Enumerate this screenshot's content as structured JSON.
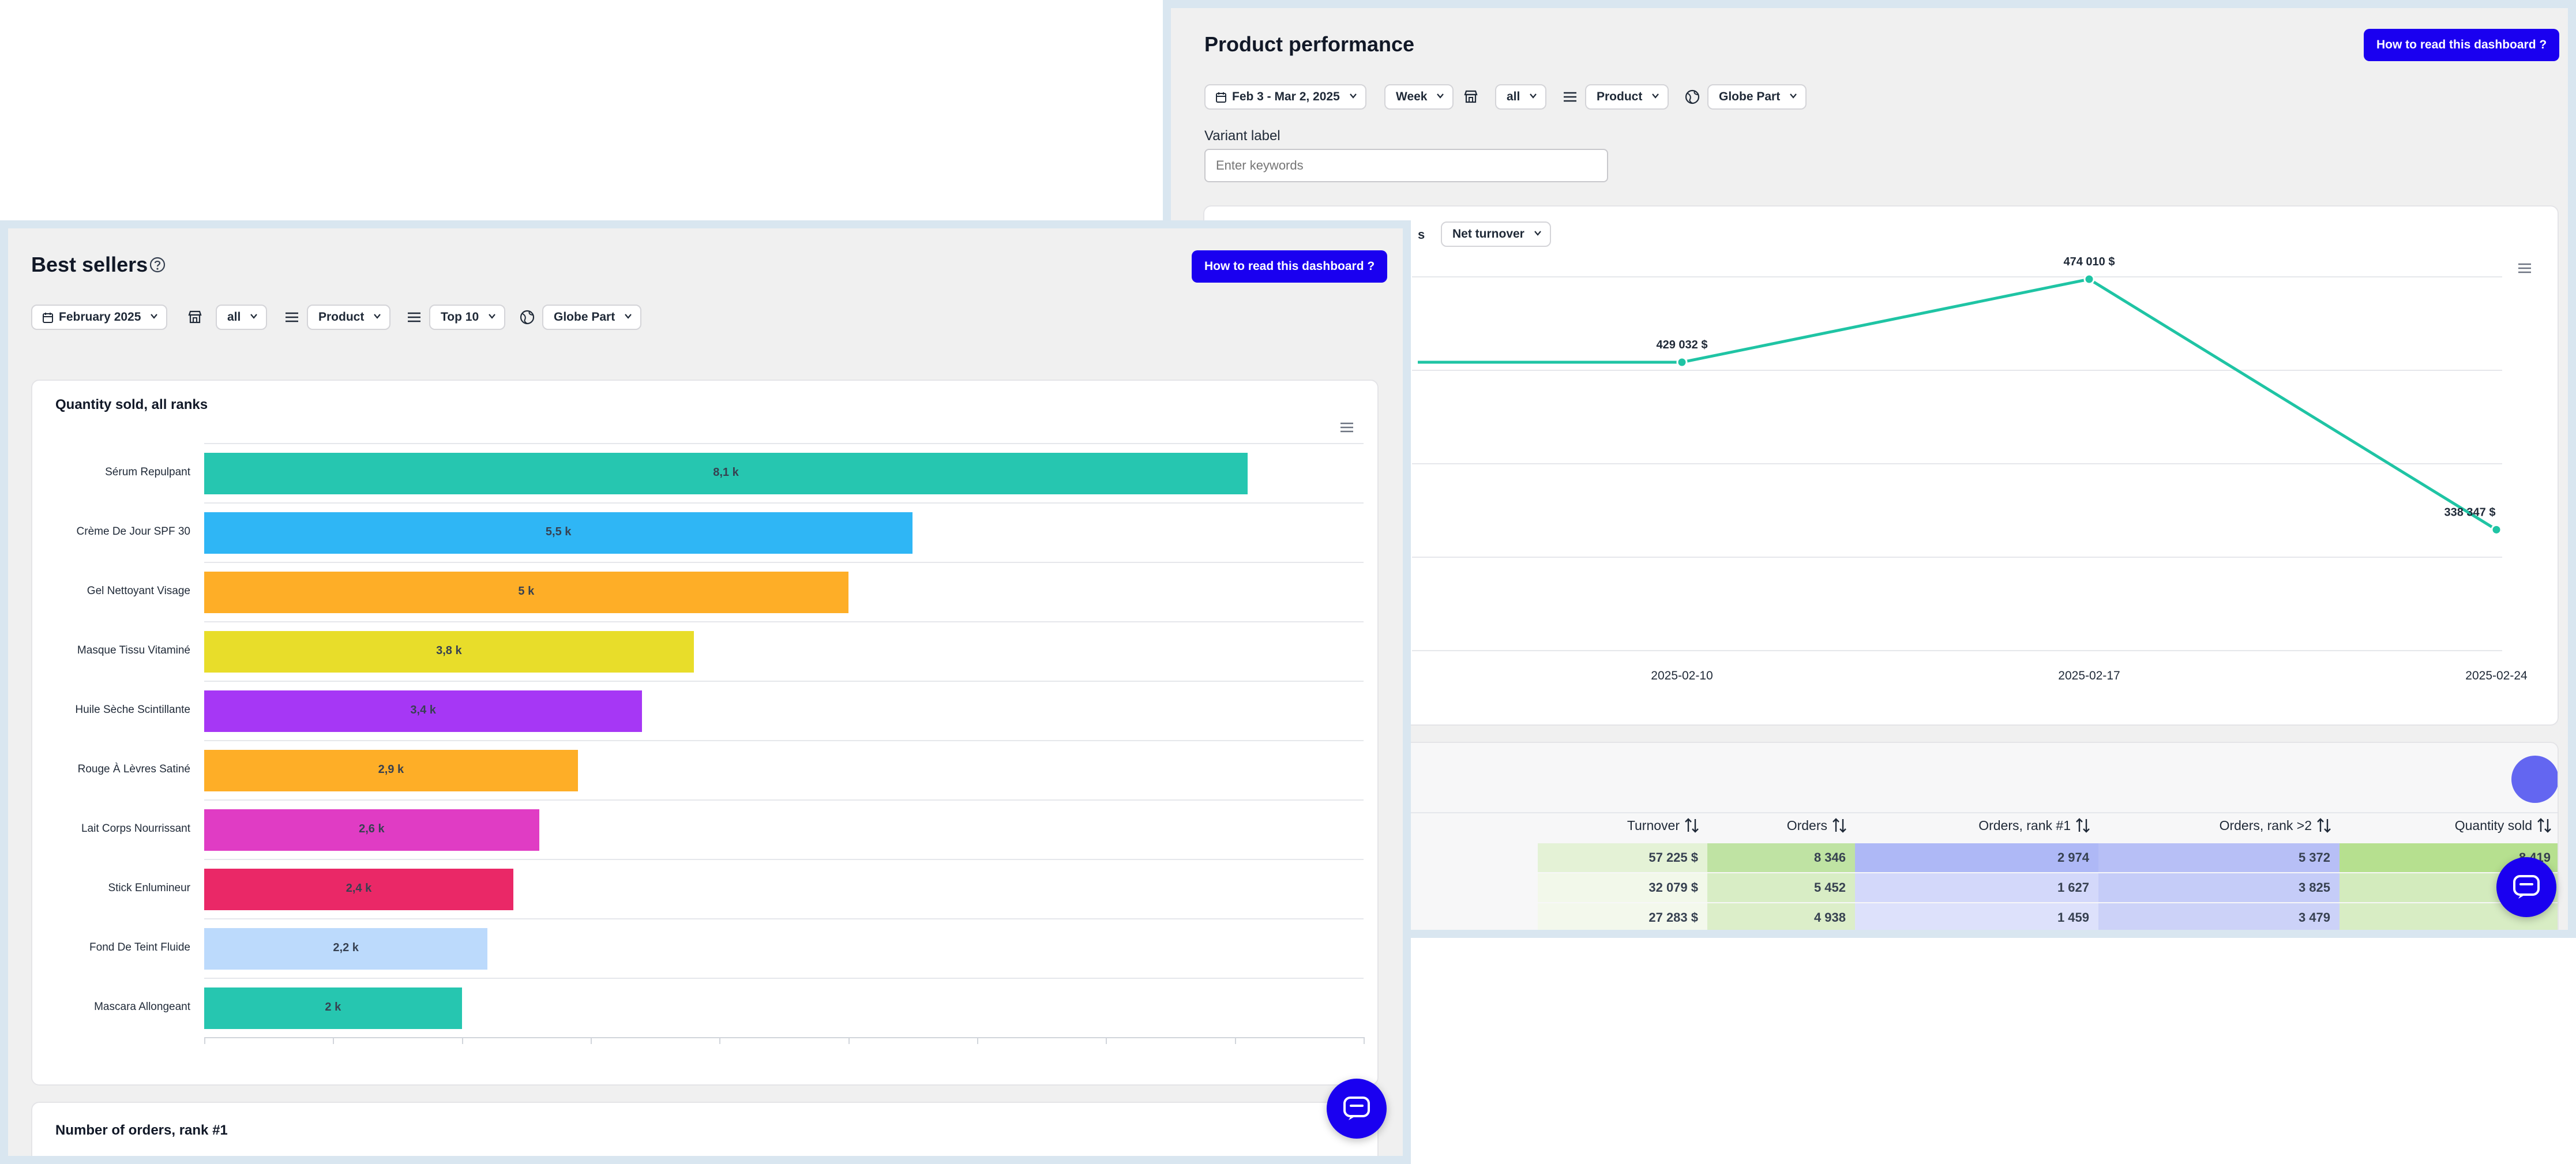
{
  "performance": {
    "title": "Product performance",
    "help_button": "How to read this dashboard ?",
    "filters": {
      "date": "Feb 3 - Mar 2, 2025",
      "granularity": "Week",
      "store": "all",
      "dimension": "Product",
      "region": "Globe Part"
    },
    "variant_label": "Variant label",
    "variant_placeholder": "Enter keywords",
    "metric_select": "Net turnover",
    "metric_select_partial": "s",
    "line_chart": {
      "points": [
        {
          "x": "2025-02-10",
          "y": 429032,
          "label": "429 032 $"
        },
        {
          "x": "2025-02-17",
          "y": 474010,
          "label": "474 010 $"
        },
        {
          "x": "2025-02-24",
          "y": 338347,
          "label": "338 347 $"
        }
      ],
      "line_color": "#1fc4a4"
    },
    "table": {
      "columns": [
        "Turnover",
        "Orders",
        "Orders, rank #1",
        "Orders, rank >2",
        "Quantity sold"
      ],
      "rows": [
        [
          "57 225 $",
          "8 346",
          "2 974",
          "5 372",
          "8 419"
        ],
        [
          "32 079 $",
          "5 452",
          "1 627",
          "3 825",
          ""
        ],
        [
          "27 283 $",
          "4 938",
          "1 459",
          "3 479",
          ""
        ]
      ]
    }
  },
  "best_sellers": {
    "title": "Best sellers",
    "help_button": "How to read this dashboard ?",
    "filters": {
      "date": "February 2025",
      "store": "all",
      "dimension": "Product",
      "top": "Top 10",
      "region": "Globe Part"
    },
    "card1_title": "Quantity sold, all ranks",
    "card2_title": "Number of orders, rank #1"
  },
  "chart_data": [
    {
      "type": "bar",
      "orientation": "horizontal",
      "title": "Quantity sold, all ranks",
      "categories": [
        "Sérum Repulpant",
        "Crème De Jour SPF 30",
        "Gel Nettoyant Visage",
        "Masque Tissu Vitaminé",
        "Huile Sèche Scintillante",
        "Rouge À Lèvres Satiné",
        "Lait Corps Nourrissant",
        "Stick Enlumineur",
        "Fond De Teint Fluide",
        "Mascara Allongeant"
      ],
      "values": [
        8100,
        5500,
        5000,
        3800,
        3400,
        2900,
        2600,
        2400,
        2200,
        2000
      ],
      "value_labels": [
        "8,1 k",
        "5,5 k",
        "5 k",
        "3,8 k",
        "3,4 k",
        "2,9 k",
        "2,6 k",
        "2,4 k",
        "2,2 k",
        "2 k"
      ],
      "colors": [
        "#26c6b0",
        "#2fb6f5",
        "#feae27",
        "#e8dd2a",
        "#a637f5",
        "#feae27",
        "#e03cc4",
        "#ea2867",
        "#bcdafc",
        "#26c6b0"
      ],
      "xlim": [
        0,
        9000
      ],
      "grid": true
    },
    {
      "type": "line",
      "x": [
        "2025-02-10",
        "2025-02-17",
        "2025-02-24"
      ],
      "series": [
        {
          "values": [
            429032,
            474010,
            338347
          ]
        }
      ]
    }
  ]
}
